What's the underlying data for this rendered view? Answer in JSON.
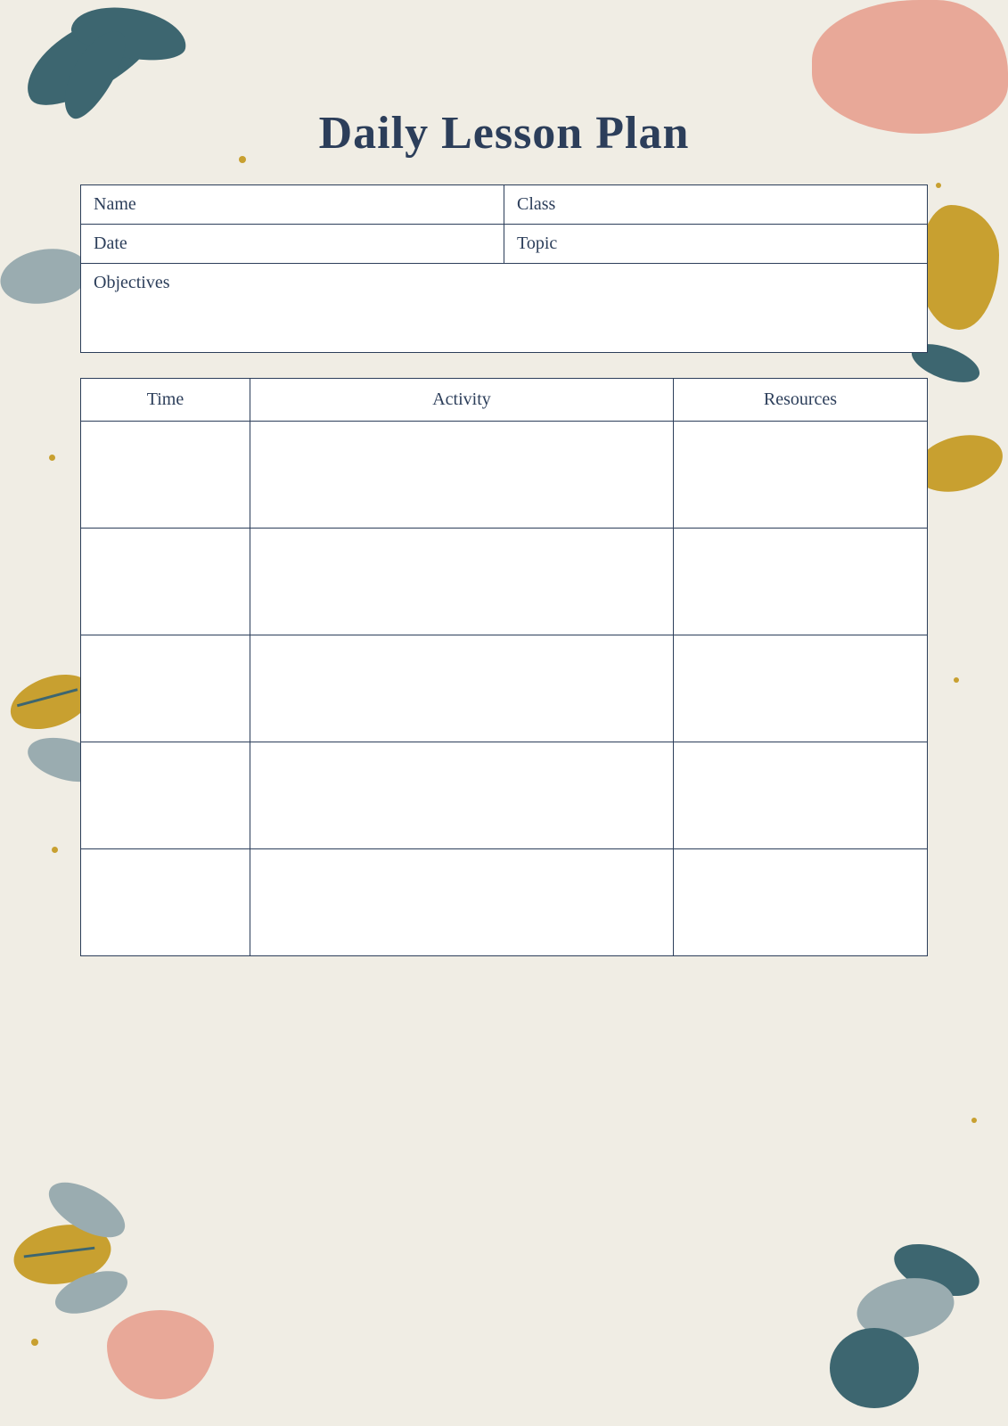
{
  "page": {
    "title": "Daily Lesson Plan",
    "fields": {
      "name_label": "Name",
      "class_label": "Class",
      "date_label": "Date",
      "topic_label": "Topic",
      "objectives_label": "Objectives"
    },
    "table": {
      "headers": [
        "Time",
        "Activity",
        "Resources"
      ],
      "rows": 5
    }
  }
}
